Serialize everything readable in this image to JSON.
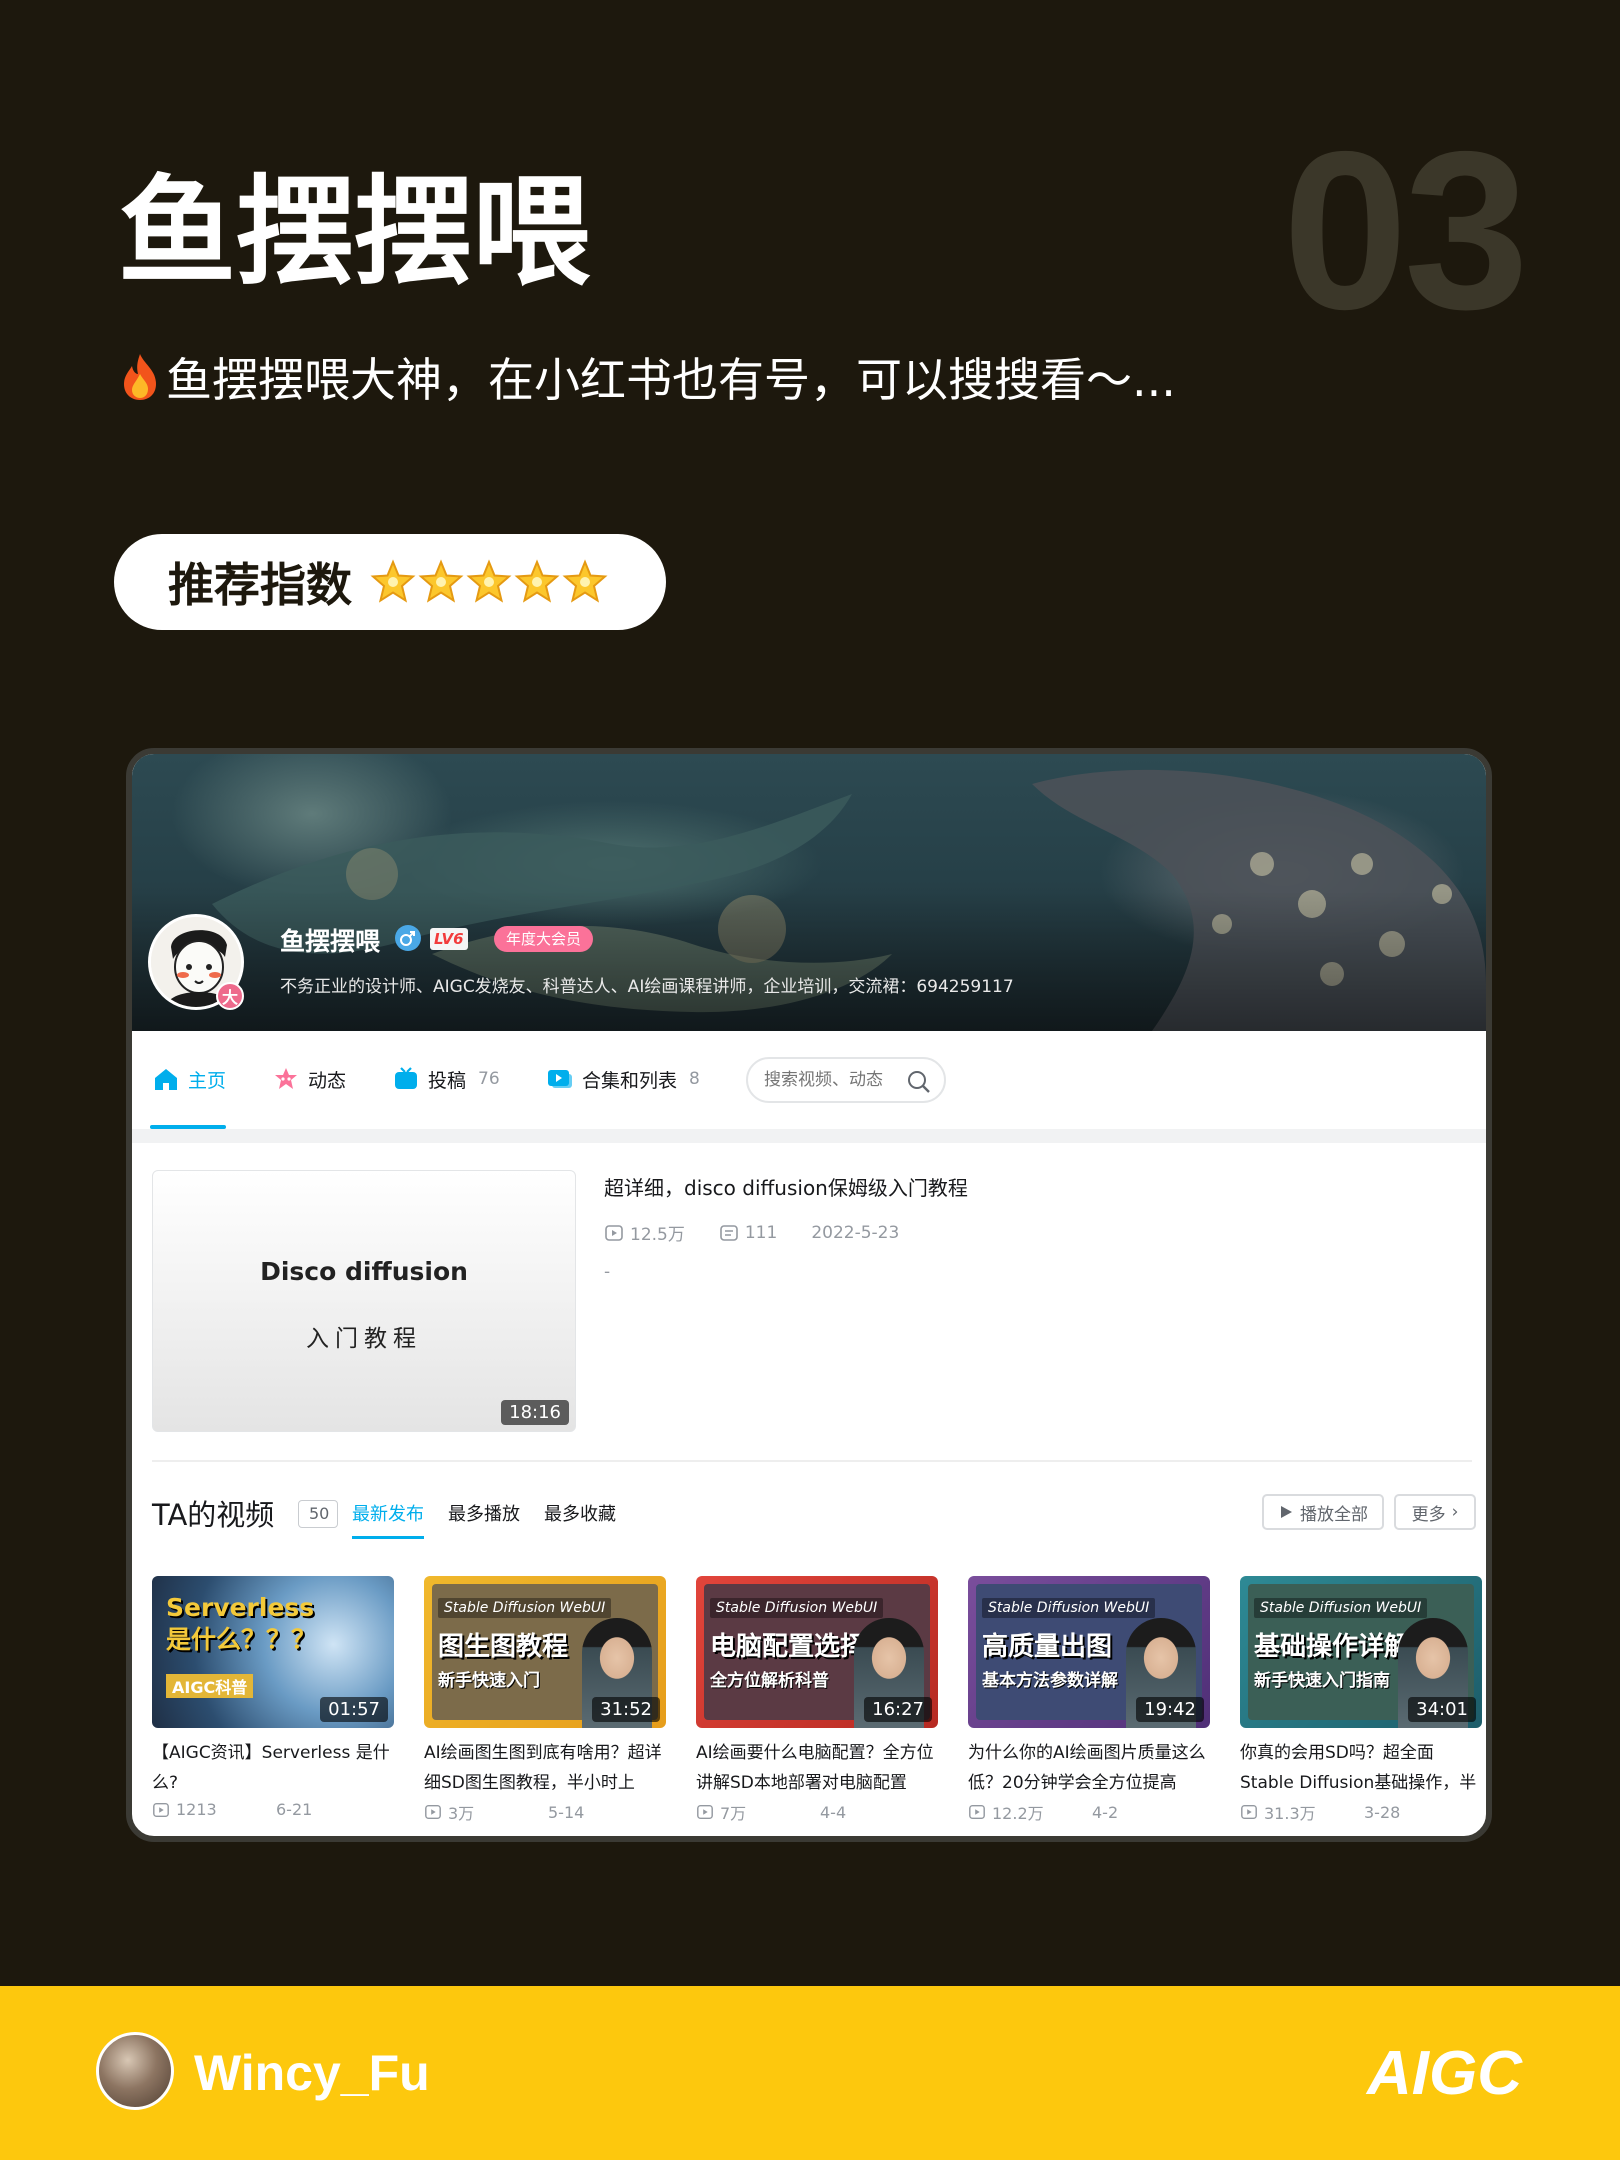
{
  "header": {
    "number": "03",
    "title": "鱼摆摆喂",
    "subtitle": "鱼摆摆喂大神，在小红书也有号，可以搜搜看～...",
    "subtitle_icon": "fire-icon",
    "recommend_label": "推荐指数",
    "recommend_stars": 5
  },
  "profile": {
    "name": "鱼摆摆喂",
    "avatar_badge": "大",
    "level": "LV6",
    "vip": "年度大会员",
    "bio": "不务正业的设计师、AIGC发烧友、科普达人、AI绘画课程讲师，企业培训，交流裙：694259117"
  },
  "nav": {
    "home": "主页",
    "dynamic": "动态",
    "uploads": "投稿",
    "uploads_count": "76",
    "collections": "合集和列表",
    "collections_count": "8",
    "search_placeholder": "搜索视频、动态"
  },
  "featured": {
    "thumb_title": "Disco diffusion",
    "thumb_subtitle": "入门教程",
    "duration": "18:16",
    "title": "超详细，disco diffusion保姆级入门教程",
    "views": "12.5万",
    "comments": "111",
    "date": "2022-5-23",
    "desc": "-"
  },
  "videos_section": {
    "title": "TA的视频",
    "count": "50",
    "tabs": [
      "最新发布",
      "最多播放",
      "最多收藏"
    ],
    "play_all": "播放全部",
    "more": "更多"
  },
  "videos": [
    {
      "chip": "",
      "big": "Serverless\n是什么？？？",
      "small": "AIGC科普",
      "duration": "01:57",
      "title": "【AIGC资讯】Serverless 是什么?",
      "views": "1213",
      "date": "6-21"
    },
    {
      "chip": "Stable Diffusion WebUI",
      "big": "图生图教程",
      "small": "新手快速入门",
      "duration": "31:52",
      "title": "AI绘画图生图到底有啥用？超详细SD图生图教程，半小时上",
      "views": "3万",
      "date": "5-14"
    },
    {
      "chip": "Stable Diffusion WebUI",
      "big": "电脑配置选择",
      "small": "全方位解析科普",
      "duration": "16:27",
      "title": "AI绘画要什么电脑配置？全方位讲解SD本地部署对电脑配置",
      "views": "7万",
      "date": "4-4"
    },
    {
      "chip": "Stable Diffusion WebUI",
      "big": "高质量出图",
      "small": "基本方法参数详解",
      "duration": "19:42",
      "title": "为什么你的AI绘画图片质量这么低？20分钟学会全方位提高",
      "views": "12.2万",
      "date": "4-2"
    },
    {
      "chip": "Stable Diffusion WebUI",
      "big": "基础操作详解",
      "small": "新手快速入门指南",
      "duration": "34:01",
      "title": "你真的会用SD吗？超全面Stable Diffusion基础操作，半",
      "views": "31.3万",
      "date": "3-28"
    }
  ],
  "footer": {
    "author": "Wincy_Fu",
    "tag": "AIGC"
  },
  "colors": {
    "background": "#1d180d",
    "footer": "#fdc80d",
    "accent_blue": "#00aeec",
    "vip_pink": "#fb7299"
  }
}
